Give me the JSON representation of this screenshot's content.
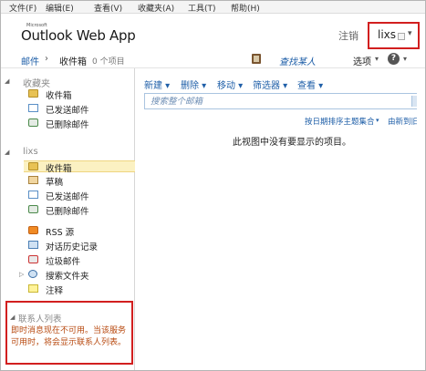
{
  "browser_menu": [
    "文件(F)",
    "编辑(E)",
    "查看(V)",
    "收藏夹(A)",
    "工具(T)",
    "帮助(H)"
  ],
  "header": {
    "microsoft": "Microsoft",
    "app_title": "Outlook Web App",
    "signout": "注销",
    "user": "lixs",
    "user_caret": "▾"
  },
  "crumb": {
    "mail": "邮件",
    "sep": "›",
    "folder": "收件箱",
    "count": "0 个项目",
    "find_people": "查找某人",
    "options": "选项",
    "caret": "▾",
    "help": "?"
  },
  "favorites": {
    "title": "收藏夹",
    "items": [
      "收件箱",
      "已发送邮件",
      "已删除邮件"
    ]
  },
  "mailbox": {
    "title": "lixs",
    "items": [
      "收件箱",
      "草稿",
      "已发送邮件",
      "已删除邮件",
      "RSS 源",
      "对话历史记录",
      "垃圾邮件",
      "搜索文件夹",
      "注释"
    ]
  },
  "contacts": {
    "title": "联系人列表",
    "message": "即时消息现在不可用。当该服务可用时，将会显示联系人列表。"
  },
  "toolbar": {
    "new": "新建 ▾",
    "delete": "删除 ▾",
    "move": "移动 ▾",
    "filter": "筛选器 ▾",
    "view": "查看 ▾"
  },
  "search": {
    "placeholder": "搜索整个邮箱"
  },
  "list": {
    "arrange": "按日期排序主题集合",
    "arrange_caret": "▾",
    "order": "由新到旧",
    "empty": "此视图中没有要显示的项目。"
  }
}
